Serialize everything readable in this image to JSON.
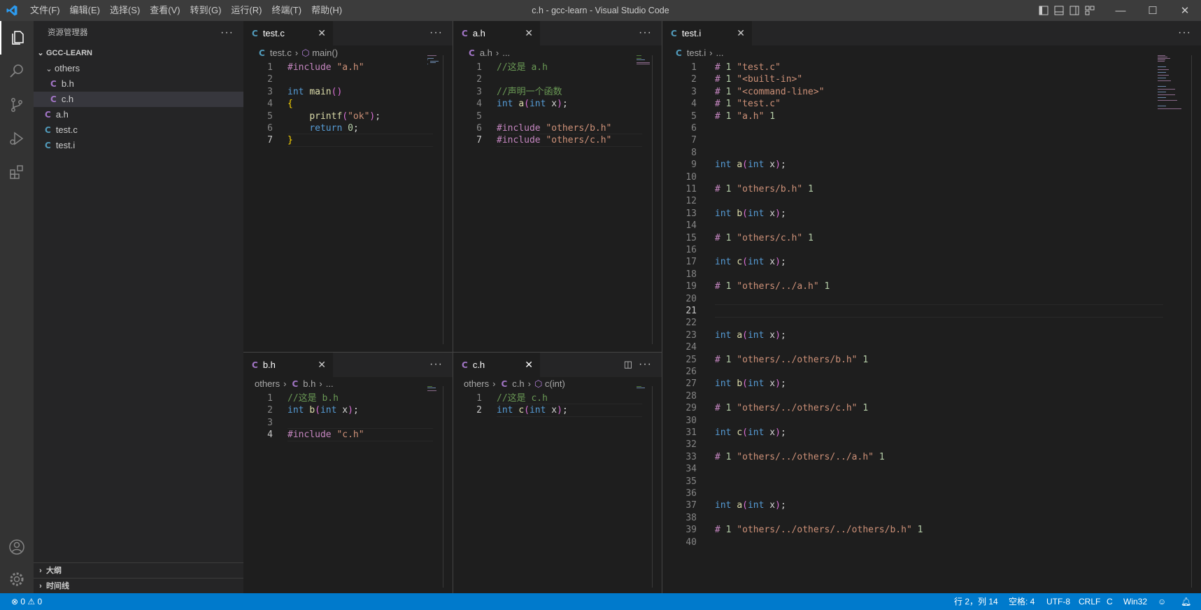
{
  "window": {
    "title": "c.h - gcc-learn - Visual Studio Code",
    "menu": [
      "文件(F)",
      "编辑(E)",
      "选择(S)",
      "查看(V)",
      "转到(G)",
      "运行(R)",
      "终端(T)",
      "帮助(H)"
    ],
    "controls": {
      "minimize": "—",
      "maximize": "☐",
      "close": "✕"
    }
  },
  "activity_bar": {
    "icons": [
      "explorer-icon",
      "search-icon",
      "source-control-icon",
      "run-debug-icon",
      "extensions-icon",
      "account-icon",
      "settings-gear-icon"
    ]
  },
  "sidebar": {
    "title": "资源管理器",
    "more": "···",
    "root": "GCC-LEARN",
    "tree": [
      {
        "label": "others",
        "kind": "folder",
        "depth": 1
      },
      {
        "label": "b.h",
        "kind": "c",
        "depth": 2
      },
      {
        "label": "c.h",
        "kind": "c",
        "depth": 2,
        "selected": true
      },
      {
        "label": "a.h",
        "kind": "c",
        "depth": 1
      },
      {
        "label": "test.c",
        "kind": "c",
        "depth": 1
      },
      {
        "label": "test.i",
        "kind": "c",
        "depth": 1
      }
    ],
    "sections": [
      "大纲",
      "时间线"
    ]
  },
  "editors": {
    "testc": {
      "tab": "test.c",
      "crumbs": [
        "test.c",
        "main()"
      ],
      "lines": [
        "#include \"a.h\"",
        "",
        "int main()",
        "{",
        "    printf(\"ok\");",
        "    return 0;",
        "}"
      ],
      "current_line": 7
    },
    "ah": {
      "tab": "a.h",
      "crumbs": [
        "a.h",
        "..."
      ],
      "lines": [
        "//这是 a.h",
        "",
        "//声明一个函数",
        "int a(int x);",
        "",
        "#include \"others/b.h\"",
        "#include \"others/c.h\""
      ],
      "current_line": 7
    },
    "bh": {
      "tab": "b.h",
      "crumbs": [
        "others",
        "b.h",
        "..."
      ],
      "lines": [
        "//这是 b.h",
        "int b(int x);",
        "",
        "#include \"c.h\""
      ],
      "current_line": 4
    },
    "ch": {
      "tab": "c.h",
      "crumbs": [
        "others",
        "c.h",
        "c(int)"
      ],
      "lines": [
        "//这是 c.h",
        "int c(int x);"
      ],
      "current_line": 2
    },
    "testi": {
      "tab": "test.i",
      "crumbs": [
        "test.i",
        "..."
      ],
      "lines": [
        "# 1 \"test.c\"",
        "# 1 \"<built-in>\"",
        "# 1 \"<command-line>\"",
        "# 1 \"test.c\"",
        "# 1 \"a.h\" 1",
        "",
        "",
        "",
        "int a(int x);",
        "",
        "# 1 \"others/b.h\" 1",
        "",
        "int b(int x);",
        "",
        "# 1 \"others/c.h\" 1",
        "",
        "int c(int x);",
        "",
        "# 1 \"others/../a.h\" 1",
        "",
        "",
        "",
        "int a(int x);",
        "",
        "# 1 \"others/../others/b.h\" 1",
        "",
        "int b(int x);",
        "",
        "# 1 \"others/../others/c.h\" 1",
        "",
        "int c(int x);",
        "",
        "# 1 \"others/../others/../a.h\" 1",
        "",
        "",
        "",
        "int a(int x);",
        "",
        "# 1 \"others/../others/../others/b.h\" 1",
        ""
      ],
      "current_line": 21
    }
  },
  "statusbar": {
    "problems": "⊗ 0 ⚠ 0",
    "position": "行 2，列 14",
    "spaces": "空格: 4",
    "encoding": "UTF-8",
    "eol": "CRLF",
    "language": "C",
    "config": "Win32"
  },
  "colors": {
    "accent": "#007acc",
    "c_icon": "#a074c4",
    "keyword": "#569cd6",
    "string": "#ce9178",
    "comment": "#6a9955",
    "preprocessor": "#c586c0"
  }
}
